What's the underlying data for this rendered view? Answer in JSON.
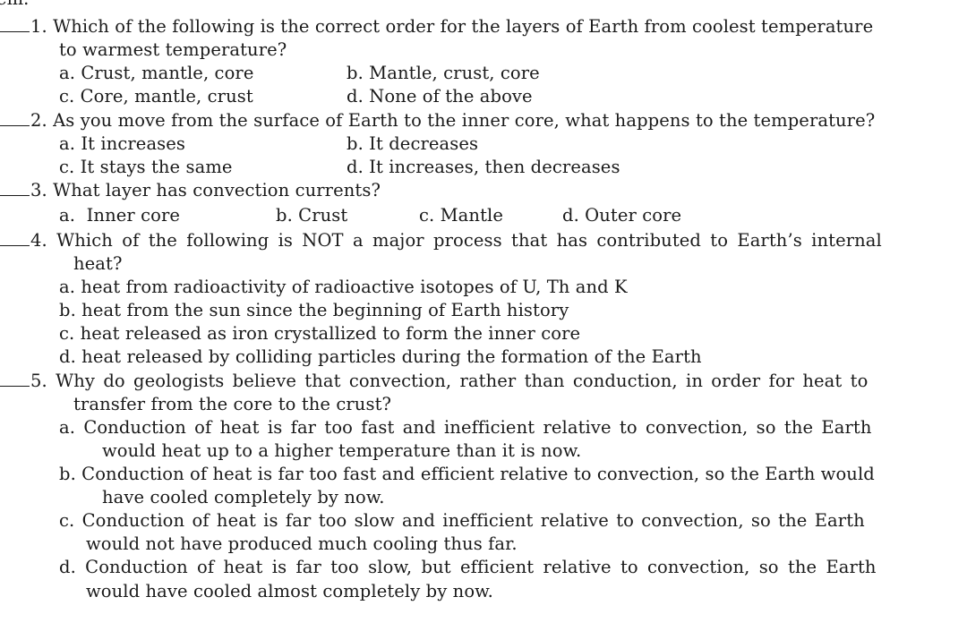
{
  "header_fragment": "tem.",
  "questions": [
    {
      "number": "1.",
      "text_line1": "Which of the following is the correct order for the layers of Earth from coolest temperature",
      "text_line2": "to warmest temperature?",
      "options": {
        "a": "a. Crust, mantle, core",
        "b": "b. Mantle, crust, core",
        "c": "c. Core, mantle, crust",
        "d": "d. None of the above"
      }
    },
    {
      "number": "2.",
      "text_line1": "As you move from the surface of Earth to the inner core, what happens to the temperature?",
      "options": {
        "a": "a. It increases",
        "b": "b. It decreases",
        "c": "c. It stays the same",
        "d": "d. It increases, then decreases"
      }
    },
    {
      "number": "3.",
      "text_line1": "What layer has convection currents?",
      "options": {
        "a": "a.  Inner core",
        "b": "b. Crust",
        "c": "c. Mantle",
        "d": "d. Outer core"
      }
    },
    {
      "number": "4.",
      "text_line1": "Which of the following is NOT a major process that has contributed to Earth’s internal",
      "text_line2": "heat?",
      "options": {
        "a": "a. heat from radioactivity of radioactive isotopes of U, Th and K",
        "b": "b. heat from the sun since the beginning of Earth history",
        "c": "c. heat released as iron crystallized to form the inner core",
        "d": "d. heat released by colliding particles during the formation of the Earth"
      }
    },
    {
      "number": "5.",
      "text_line1": "Why do geologists believe that convection, rather than conduction, in order for heat to",
      "text_line2": "transfer from the core to the crust?",
      "options": {
        "a_line1": "a. Conduction of heat is far too fast and inefficient relative to convection, so the Earth",
        "a_line2": "would heat up to a higher temperature than it is now.",
        "b_line1": "b. Conduction of heat is far too fast and efficient relative to convection, so the Earth would",
        "b_line2": "have cooled completely by now.",
        "c_line1": "c. Conduction of heat is far too slow and inefficient relative to convection, so the Earth",
        "c_line2": "would not have produced much cooling thus far.",
        "d_line1": "d. Conduction of heat is far too slow, but efficient relative to convection, so the Earth",
        "d_line2": "would have cooled almost completely by now."
      }
    }
  ]
}
